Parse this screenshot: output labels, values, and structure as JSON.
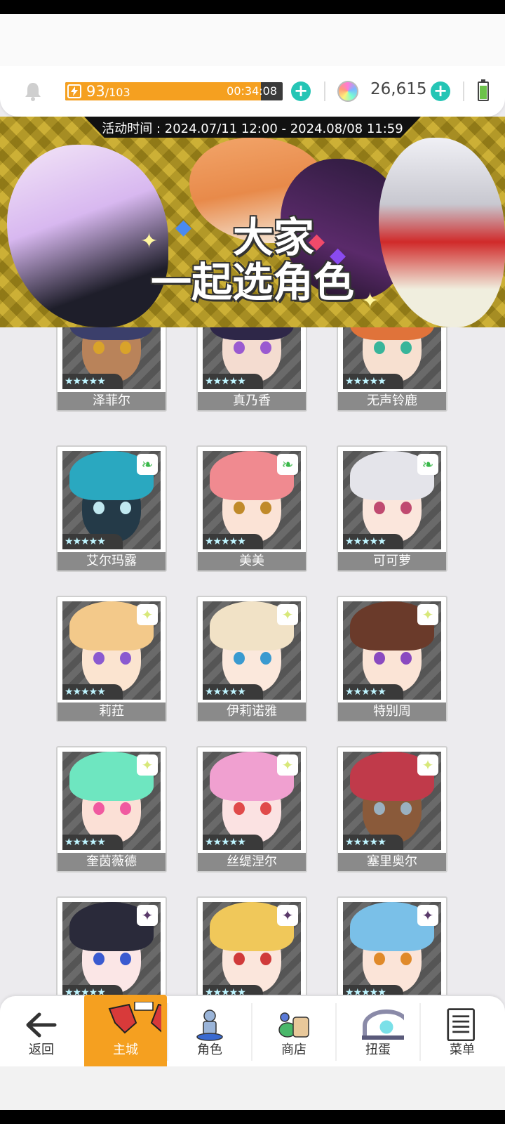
{
  "topbar": {
    "stamina_current": "93",
    "stamina_max": "/103",
    "stamina_fraction": 0.9,
    "stamina_timer": "00:34:08",
    "gem_count": "26,615"
  },
  "banner": {
    "event_time": "活动时间 : 2024.07/11 12:00 - 2024.08/08 11:59",
    "title_line1": "大家",
    "title_line2": "一起选角色"
  },
  "characters": [
    {
      "name": "泽菲尔",
      "stars": "★★★★★",
      "element": "",
      "hair": "#3b3f6b",
      "skin": "#b9835a",
      "eye": "#d9a32a"
    },
    {
      "name": "真乃香",
      "stars": "★★★★★",
      "element": "",
      "hair": "#2e2748",
      "skin": "#f4dcd0",
      "eye": "#9a5ad0"
    },
    {
      "name": "无声铃鹿",
      "stars": "★★★★★",
      "element": "",
      "hair": "#e0733a",
      "skin": "#f7e0d0",
      "eye": "#38b59a"
    },
    {
      "name": "艾尔玛露",
      "stars": "★★★★★",
      "element": "❧",
      "hair": "#2aa8c0",
      "skin": "#243a48",
      "eye": "#c0e8f0"
    },
    {
      "name": "美美",
      "stars": "★★★★★",
      "element": "❧",
      "hair": "#f08a90",
      "skin": "#fbe3d6",
      "eye": "#c08a2a"
    },
    {
      "name": "可可萝",
      "stars": "★★★★★",
      "element": "❧",
      "hair": "#e4e4ea",
      "skin": "#fbe6dc",
      "eye": "#c04a70"
    },
    {
      "name": "莉菈",
      "stars": "★★★★★",
      "element": "✦",
      "hair": "#f3c98a",
      "skin": "#fbe4d0",
      "eye": "#8a5ad0"
    },
    {
      "name": "伊莉诺雅",
      "stars": "★★★★★",
      "element": "✦",
      "hair": "#f1e2c6",
      "skin": "#fbe8dc",
      "eye": "#3a9ad0"
    },
    {
      "name": "特别周",
      "stars": "★★★★★",
      "element": "✦",
      "hair": "#6a3a2a",
      "skin": "#fbe4d6",
      "eye": "#8a4ac0"
    },
    {
      "name": "奎茵薇德",
      "stars": "★★★★★",
      "element": "✦",
      "hair": "#6ee6c0",
      "skin": "#fbe0d6",
      "eye": "#f05aa0"
    },
    {
      "name": "丝缇涅尔",
      "stars": "★★★★★",
      "element": "✦",
      "hair": "#f0a0d0",
      "skin": "#fbe2e2",
      "eye": "#e04a4a"
    },
    {
      "name": "塞里奥尔",
      "stars": "★★★★★",
      "element": "✦",
      "hair": "#c03a4a",
      "skin": "#8a5a3a",
      "eye": "#9ab0c0"
    },
    {
      "name": "",
      "stars": "★★★★★",
      "element": "✦",
      "hair": "#2a2a3a",
      "skin": "#fbe6e6",
      "eye": "#3a5ad0"
    },
    {
      "name": "",
      "stars": "★★★★★",
      "element": "✦",
      "hair": "#f0c85a",
      "skin": "#fbe6dc",
      "eye": "#d03a3a"
    },
    {
      "name": "",
      "stars": "★★★★★",
      "element": "✦",
      "hair": "#7ac0e8",
      "skin": "#fbe4d8",
      "eye": "#e08a2a"
    }
  ],
  "nav": {
    "back": "返回",
    "home": "主城",
    "characters": "角色",
    "shop": "商店",
    "gacha": "扭蛋",
    "menu": "菜单"
  },
  "colors": {
    "accent": "#f5a020",
    "plus_button": "#25c5b5",
    "banner_bg": "#c7a820"
  }
}
